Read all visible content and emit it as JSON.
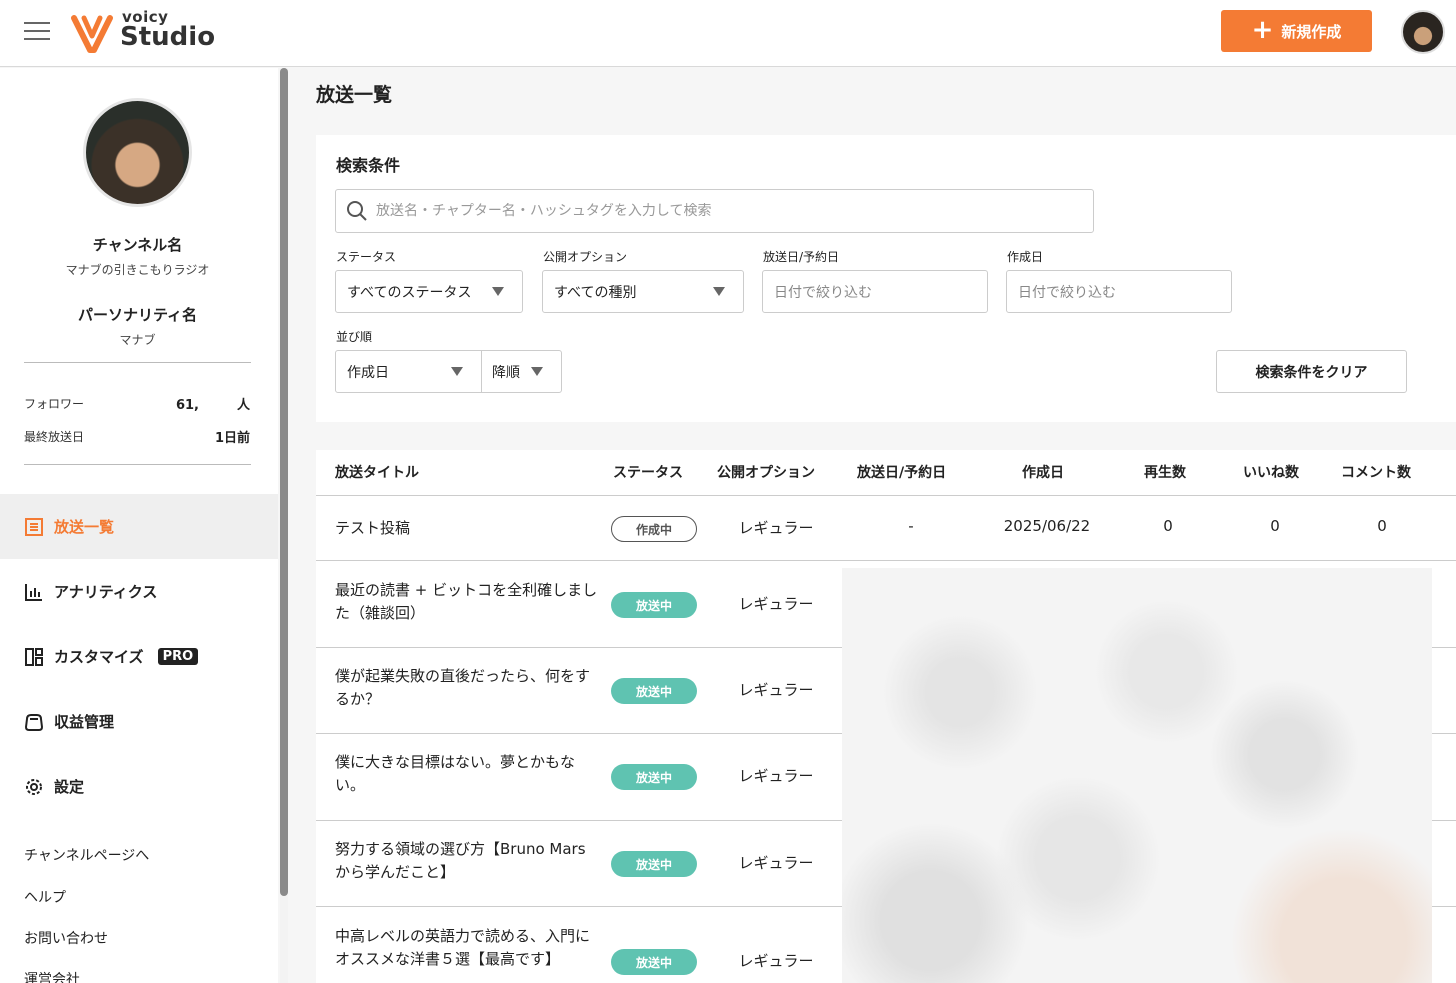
{
  "header": {
    "logo_voicy": "voicy",
    "logo_studio": "Studio",
    "new_button": "新規作成"
  },
  "sidebar": {
    "channel_label": "チャンネル名",
    "channel_name": "マナブの引きこもりラジオ",
    "personality_label": "パーソナリティ名",
    "personality_name": "マナブ",
    "stats": [
      {
        "label": "フォロワー",
        "value": "61,",
        "suffix": "人"
      },
      {
        "label": "最終放送日",
        "value": "1日前"
      }
    ],
    "nav": [
      {
        "label": "放送一覧",
        "icon": "list-icon",
        "active": true
      },
      {
        "label": "アナリティクス",
        "icon": "bar-chart-icon"
      },
      {
        "label": "カスタマイズ",
        "icon": "customize-icon",
        "badge": "PRO"
      },
      {
        "label": "収益管理",
        "icon": "wallet-icon"
      },
      {
        "label": "設定",
        "icon": "gear-icon"
      }
    ],
    "links": [
      "チャンネルページへ",
      "ヘルプ",
      "お問い合わせ",
      "運営会社"
    ]
  },
  "main": {
    "title": "放送一覧",
    "search_panel": {
      "title": "検索条件",
      "search_placeholder": "放送名・チャプター名・ハッシュタグを入力して検索",
      "status_label": "ステータス",
      "status_value": "すべてのステータス",
      "option_label": "公開オプション",
      "option_value": "すべての種別",
      "broadcast_date_label": "放送日/予約日",
      "broadcast_date_placeholder": "日付で絞り込む",
      "created_label": "作成日",
      "created_placeholder": "日付で絞り込む",
      "sort_label": "並び順",
      "sort_field": "作成日",
      "sort_order": "降順",
      "clear_button": "検索条件をクリア"
    },
    "table": {
      "columns": [
        "放送タイトル",
        "ステータス",
        "公開オプション",
        "放送日/予約日",
        "作成日",
        "再生数",
        "いいね数",
        "コメント数"
      ],
      "rows": [
        {
          "title": "テスト投稿",
          "status": "作成中",
          "option": "レギュラー",
          "broadcast_date": "-",
          "created": "2025/06/22",
          "plays": "0",
          "likes": "0",
          "comments": "0"
        },
        {
          "title": "最近の読書 + ビットコを全利確しました（雑談回）",
          "status": "放送中",
          "option": "レギュラー"
        },
        {
          "title": "僕が起業失敗の直後だったら、何をするか？",
          "status": "放送中",
          "option": "レギュラー"
        },
        {
          "title": "僕に大きな目標はない。夢とかもない。",
          "status": "放送中",
          "option": "レギュラー"
        },
        {
          "title": "努力する領域の選び方【Bruno Marsから学んだこと】",
          "status": "放送中",
          "option": "レギュラー"
        },
        {
          "title": "中高レベルの英語力で読める、入門にオススメな洋書５選【最高です】",
          "status": "放送中",
          "option": "レギュラー"
        }
      ]
    }
  },
  "colors": {
    "accent": "#f47b34",
    "status_live": "#5fc3b1"
  }
}
